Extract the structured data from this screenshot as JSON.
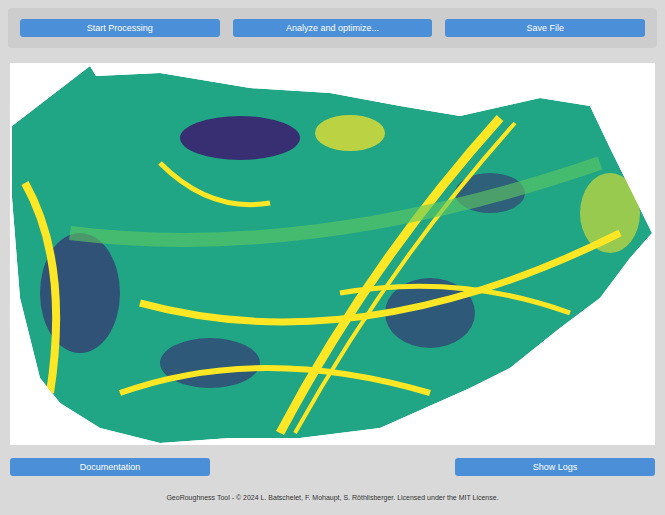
{
  "toolbar": {
    "buttons": [
      {
        "label": "Start Processing"
      },
      {
        "label": "Analyze and optimize..."
      },
      {
        "label": "Save File"
      }
    ]
  },
  "bottom_bar": {
    "buttons": [
      {
        "label": "Documentation"
      },
      {
        "label": "Show Logs"
      }
    ]
  },
  "footer": "GeoRoughness Tool - © 2024 L. Batschelet, F. Mohaupt, S. Röthlisberger. Licensed under the MIT License."
}
